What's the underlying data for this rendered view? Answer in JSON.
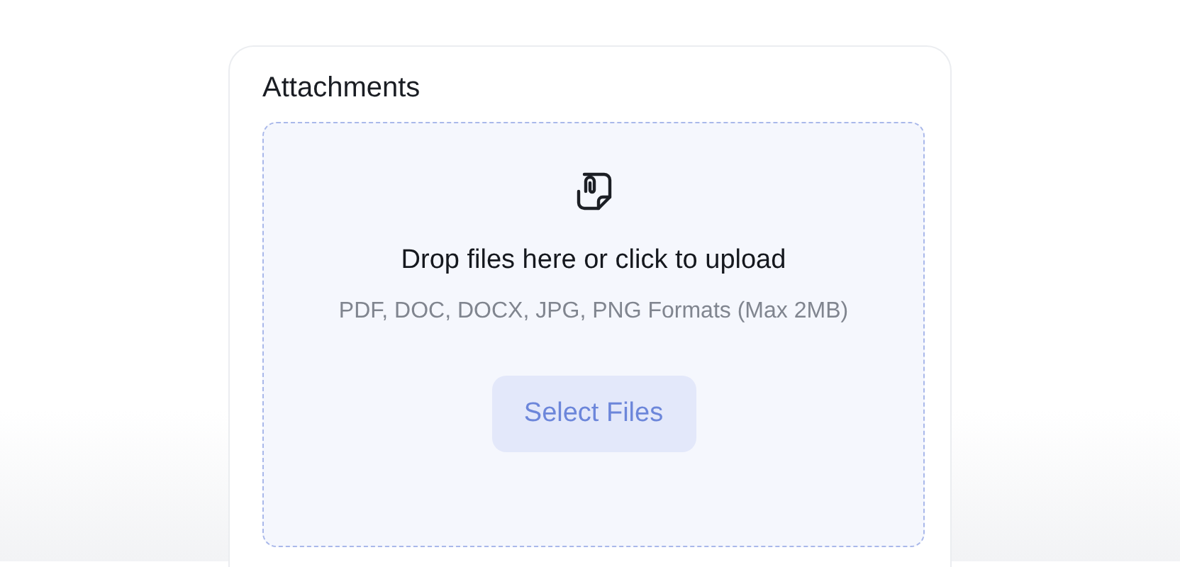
{
  "card": {
    "title": "Attachments"
  },
  "dropzone": {
    "heading": "Drop files here or click to upload",
    "hint": "PDF, DOC, DOCX, JPG, PNG Formats (Max 2MB)",
    "button": "Select Files"
  }
}
